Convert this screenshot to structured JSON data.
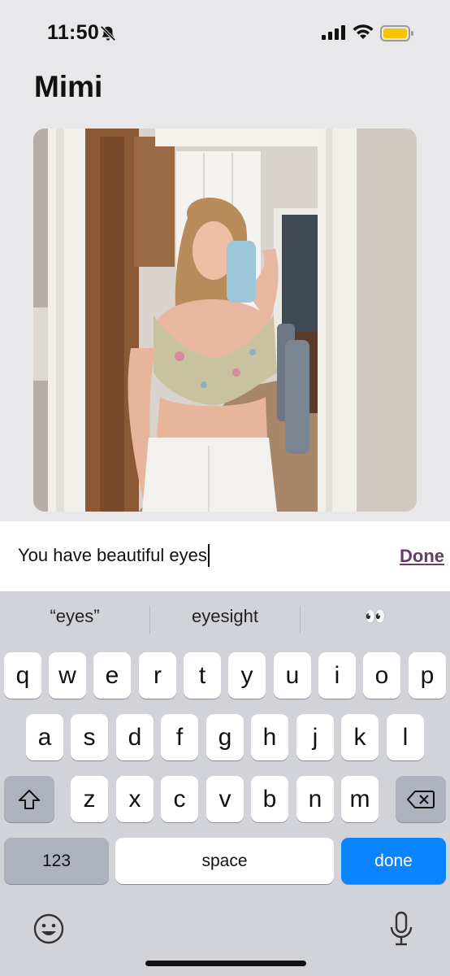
{
  "status_bar": {
    "time": "11:50"
  },
  "app": {
    "title": "Mimi"
  },
  "message": {
    "text": "You have beautiful eyes",
    "done_label": "Done"
  },
  "keyboard": {
    "suggestions": [
      "“eyes”",
      "eyesight",
      "👀"
    ],
    "row1": [
      "q",
      "w",
      "e",
      "r",
      "t",
      "y",
      "u",
      "i",
      "o",
      "p"
    ],
    "row2": [
      "a",
      "s",
      "d",
      "f",
      "g",
      "h",
      "j",
      "k",
      "l"
    ],
    "row3": [
      "z",
      "x",
      "c",
      "v",
      "b",
      "n",
      "m"
    ],
    "numbers_label": "123",
    "space_label": "space",
    "return_label": "done",
    "accent_color": "#0a84ff"
  },
  "icons": [
    "bell-slash-icon",
    "signal-icon",
    "wifi-icon",
    "battery-icon",
    "shift-icon",
    "delete-icon",
    "emoji-icon",
    "microphone-icon"
  ],
  "colors": {
    "battery": "#f7c600",
    "done_link": "#6a3a6a"
  }
}
